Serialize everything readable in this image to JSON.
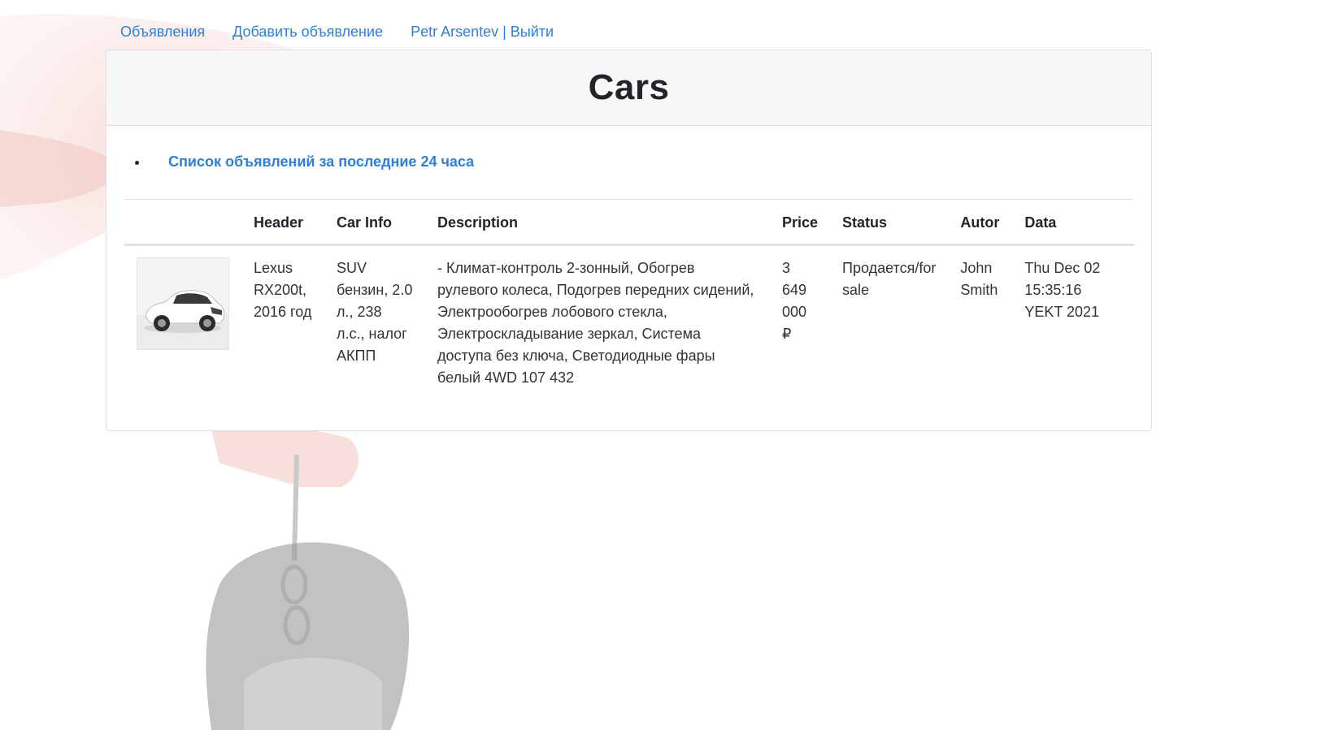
{
  "nav": {
    "ads_link": "Объявления",
    "add_ad_link": "Добавить объявление",
    "user_logout_link": "Petr Arsentev | Выйти"
  },
  "header": {
    "title": "Cars"
  },
  "filters": {
    "last24_link": "Список объявлений за последние 24 часа"
  },
  "table": {
    "columns": [
      "",
      "Header",
      "Car Info",
      "Description",
      "Price",
      "Status",
      "Autor",
      "Data"
    ],
    "rows": [
      {
        "image_icon": "car-photo",
        "header": "Lexus RX200t, 2016 год",
        "car_info": "SUV бензин, 2.0 л., 238 л.с., налог АКПП",
        "description": "- Климат-контроль 2-зонный, Обогрев рулевого колеса, Подогрев передних сидений, Электрообогрев лобового стекла, Электроскладывание зеркал, Система доступа без ключа, Светодиодные фары белый 4WD 107 432",
        "price": "3 649 000 ₽",
        "status": "Продается/for sale",
        "autor": "John Smith",
        "data": "Thu Dec 02 15:35:16 YEKT 2021"
      }
    ]
  },
  "colors": {
    "link": "#2f7fd6",
    "header_bg": "#f7f7f7",
    "border": "#dee2e6"
  }
}
